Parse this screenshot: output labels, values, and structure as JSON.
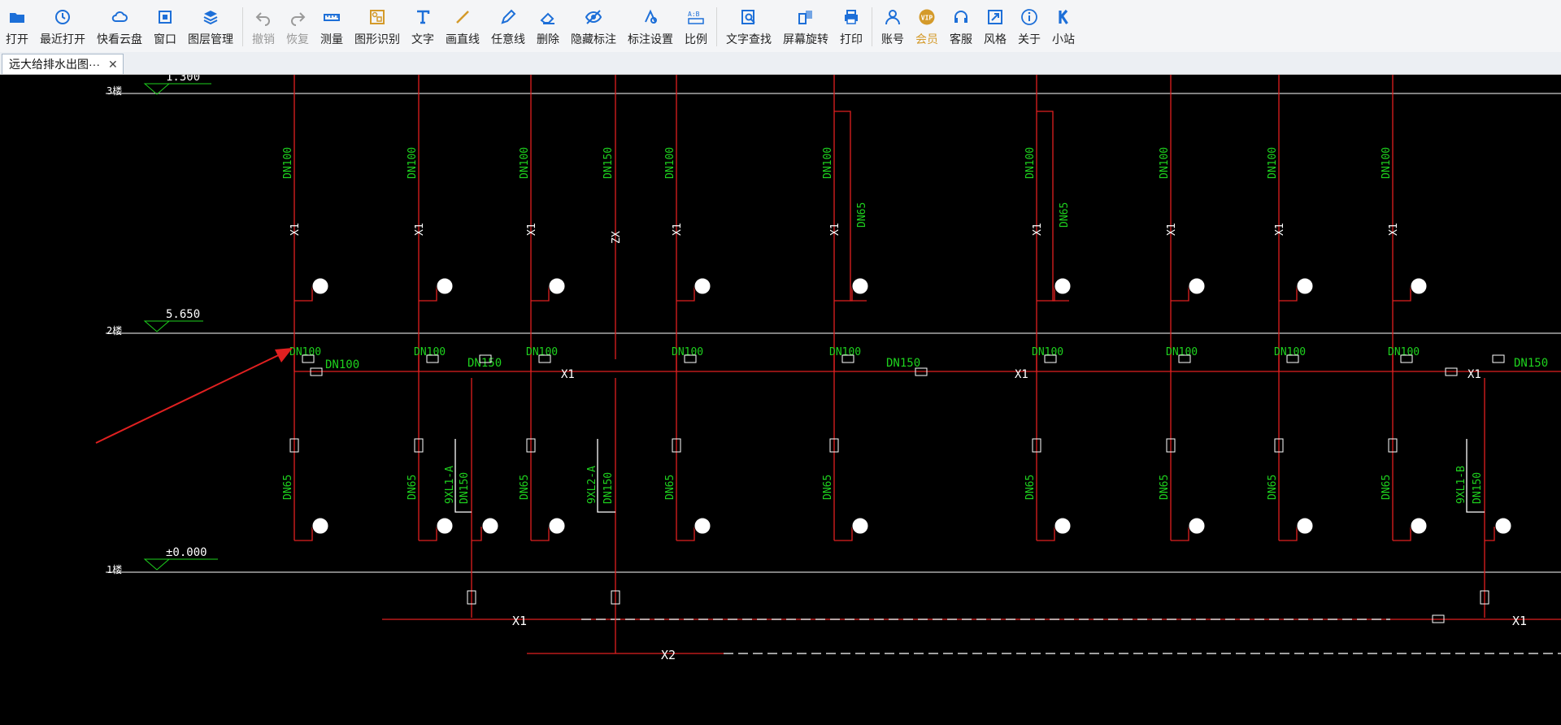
{
  "toolbar": {
    "buttons": [
      {
        "label": "打开",
        "icon": "folder-open-icon",
        "color": "#1d6fd8"
      },
      {
        "label": "最近打开",
        "icon": "clock-icon",
        "color": "#1d6fd8"
      },
      {
        "label": "快看云盘",
        "icon": "cloud-icon",
        "color": "#1d6fd8"
      },
      {
        "label": "窗口",
        "icon": "window-icon",
        "color": "#1d6fd8"
      },
      {
        "label": "图层管理",
        "icon": "layers-icon",
        "color": "#1d6fd8"
      },
      {
        "label": "撤销",
        "icon": "undo-icon",
        "color": "#9a9a9a"
      },
      {
        "label": "恢复",
        "icon": "redo-icon",
        "color": "#9a9a9a"
      },
      {
        "label": "测量",
        "icon": "ruler-icon",
        "color": "#1d6fd8"
      },
      {
        "label": "图形识别",
        "icon": "shape-recognize-icon",
        "color": "#d49a2a"
      },
      {
        "label": "文字",
        "icon": "text-icon",
        "color": "#1d6fd8"
      },
      {
        "label": "画直线",
        "icon": "line-icon",
        "color": "#d49a2a"
      },
      {
        "label": "任意线",
        "icon": "pencil-icon",
        "color": "#1d6fd8"
      },
      {
        "label": "删除",
        "icon": "eraser-icon",
        "color": "#1d6fd8"
      },
      {
        "label": "隐藏标注",
        "icon": "eye-hide-icon",
        "color": "#1d6fd8"
      },
      {
        "label": "标注设置",
        "icon": "annotation-settings-icon",
        "color": "#1d6fd8"
      },
      {
        "label": "比例",
        "icon": "scale-icon",
        "color": "#1d6fd8"
      },
      {
        "label": "文字查找",
        "icon": "text-search-icon",
        "color": "#1d6fd8"
      },
      {
        "label": "屏幕旋转",
        "icon": "rotate-screen-icon",
        "color": "#1d6fd8"
      },
      {
        "label": "打印",
        "icon": "printer-icon",
        "color": "#1d6fd8"
      },
      {
        "label": "账号",
        "icon": "user-icon",
        "color": "#1d6fd8"
      },
      {
        "label": "会员",
        "icon": "vip-icon",
        "color": "#d49a2a"
      },
      {
        "label": "客服",
        "icon": "headset-icon",
        "color": "#1d6fd8"
      },
      {
        "label": "风格",
        "icon": "style-icon",
        "color": "#1d6fd8"
      },
      {
        "label": "关于",
        "icon": "info-icon",
        "color": "#1d6fd8"
      },
      {
        "label": "小站",
        "icon": "k-logo-icon",
        "color": "#1d6fd8"
      }
    ]
  },
  "tabs": {
    "active_title": "远大给排水出图···",
    "close_glyph": "✕"
  },
  "drawing": {
    "colors": {
      "pipe": "#e02020",
      "label": "#1ed21e",
      "line": "#ffffff",
      "background": "#000000"
    },
    "floors": {
      "f3": "3楼",
      "f2": "2楼",
      "f1": "1楼"
    },
    "elevations": {
      "f3": "1.300",
      "f2": "5.650",
      "f1": "±0.000"
    },
    "labels": {
      "dn100": "DN100",
      "dn150": "DN150",
      "dn65": "DN65",
      "x1": "X1",
      "x2": "X2",
      "z_x": "ZX",
      "riser_a": "9XL1-A",
      "riser_b": "9XL1-B",
      "riser_2a": "9XL2-A"
    }
  }
}
